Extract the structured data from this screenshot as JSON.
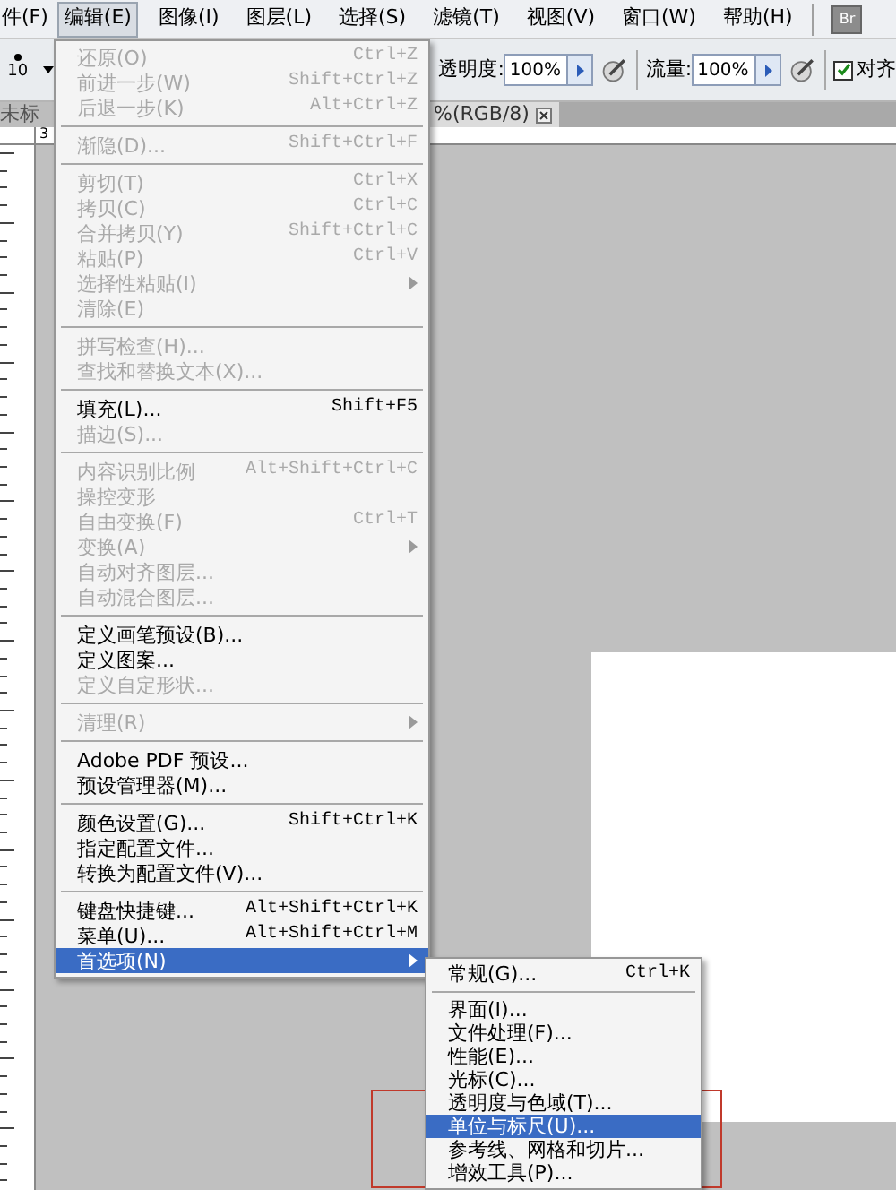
{
  "menubar": {
    "items": [
      {
        "label": "件(F)",
        "selected": false
      },
      {
        "label": "编辑(E)",
        "selected": true
      },
      {
        "label": "图像(I)",
        "selected": false
      },
      {
        "label": "图层(L)",
        "selected": false
      },
      {
        "label": "选择(S)",
        "selected": false
      },
      {
        "label": "滤镜(T)",
        "selected": false
      },
      {
        "label": "视图(V)",
        "selected": false
      },
      {
        "label": "窗口(W)",
        "selected": false
      },
      {
        "label": "帮助(H)",
        "selected": false
      }
    ],
    "bridge_button": "Br"
  },
  "options_bar": {
    "brush_size": "10",
    "opacity_label": "透明度:",
    "opacity_value": "100%",
    "flow_label": "流量:",
    "flow_value": "100%",
    "align": {
      "label": "对齐",
      "checked": true
    }
  },
  "document_tabs": [
    {
      "label": "未标",
      "selected": false
    },
    {
      "label": "%(RGB/8)",
      "selected": true
    }
  ],
  "ruler": {
    "label": "3"
  },
  "edit_menu": {
    "items": [
      {
        "kind": "item",
        "label": "还原(O)",
        "shortcut": "Ctrl+Z",
        "disabled": true
      },
      {
        "kind": "item",
        "label": "前进一步(W)",
        "shortcut": "Shift+Ctrl+Z",
        "disabled": true
      },
      {
        "kind": "item",
        "label": "后退一步(K)",
        "shortcut": "Alt+Ctrl+Z",
        "disabled": true
      },
      {
        "kind": "separator"
      },
      {
        "kind": "item",
        "label": "渐隐(D)...",
        "shortcut": "Shift+Ctrl+F",
        "disabled": true
      },
      {
        "kind": "separator"
      },
      {
        "kind": "item",
        "label": "剪切(T)",
        "shortcut": "Ctrl+X",
        "disabled": true
      },
      {
        "kind": "item",
        "label": "拷贝(C)",
        "shortcut": "Ctrl+C",
        "disabled": true
      },
      {
        "kind": "item",
        "label": "合并拷贝(Y)",
        "shortcut": "Shift+Ctrl+C",
        "disabled": true
      },
      {
        "kind": "item",
        "label": "粘贴(P)",
        "shortcut": "Ctrl+V",
        "disabled": true
      },
      {
        "kind": "item",
        "label": "选择性粘贴(I)",
        "submenu": true,
        "disabled": true
      },
      {
        "kind": "item",
        "label": "清除(E)",
        "disabled": true
      },
      {
        "kind": "separator"
      },
      {
        "kind": "item",
        "label": "拼写检查(H)...",
        "disabled": true
      },
      {
        "kind": "item",
        "label": "查找和替换文本(X)...",
        "disabled": true
      },
      {
        "kind": "separator"
      },
      {
        "kind": "item",
        "label": "填充(L)...",
        "shortcut": "Shift+F5",
        "disabled": false
      },
      {
        "kind": "item",
        "label": "描边(S)...",
        "disabled": true
      },
      {
        "kind": "separator"
      },
      {
        "kind": "item",
        "label": "内容识别比例",
        "shortcut": "Alt+Shift+Ctrl+C",
        "disabled": true
      },
      {
        "kind": "item",
        "label": "操控变形",
        "disabled": true
      },
      {
        "kind": "item",
        "label": "自由变换(F)",
        "shortcut": "Ctrl+T",
        "disabled": true
      },
      {
        "kind": "item",
        "label": "变换(A)",
        "submenu": true,
        "disabled": true
      },
      {
        "kind": "item",
        "label": "自动对齐图层...",
        "disabled": true
      },
      {
        "kind": "item",
        "label": "自动混合图层...",
        "disabled": true
      },
      {
        "kind": "separator"
      },
      {
        "kind": "item",
        "label": "定义画笔预设(B)...",
        "disabled": false
      },
      {
        "kind": "item",
        "label": "定义图案...",
        "disabled": false
      },
      {
        "kind": "item",
        "label": "定义自定形状...",
        "disabled": true
      },
      {
        "kind": "separator"
      },
      {
        "kind": "item",
        "label": "清理(R)",
        "submenu": true,
        "disabled": true
      },
      {
        "kind": "separator"
      },
      {
        "kind": "item",
        "label": "Adobe PDF 预设...",
        "disabled": false
      },
      {
        "kind": "item",
        "label": "预设管理器(M)...",
        "disabled": false
      },
      {
        "kind": "separator"
      },
      {
        "kind": "item",
        "label": "颜色设置(G)...",
        "shortcut": "Shift+Ctrl+K",
        "disabled": false
      },
      {
        "kind": "item",
        "label": "指定配置文件...",
        "disabled": false
      },
      {
        "kind": "item",
        "label": "转换为配置文件(V)...",
        "disabled": false
      },
      {
        "kind": "separator"
      },
      {
        "kind": "item",
        "label": "键盘快捷键...",
        "shortcut": "Alt+Shift+Ctrl+K",
        "disabled": false
      },
      {
        "kind": "item",
        "label": "菜单(U)...",
        "shortcut": "Alt+Shift+Ctrl+M",
        "disabled": false
      },
      {
        "kind": "item",
        "label": "首选项(N)",
        "submenu": true,
        "disabled": false,
        "selected": true
      }
    ]
  },
  "preferences_submenu": {
    "items": [
      {
        "kind": "item",
        "label": "常规(G)...",
        "shortcut": "Ctrl+K",
        "selected": false
      },
      {
        "kind": "separator"
      },
      {
        "kind": "item",
        "label": "界面(I)...",
        "selected": false
      },
      {
        "kind": "item",
        "label": "文件处理(F)...",
        "selected": false
      },
      {
        "kind": "item",
        "label": "性能(E)...",
        "selected": false
      },
      {
        "kind": "item",
        "label": "光标(C)...",
        "selected": false
      },
      {
        "kind": "item",
        "label": "透明度与色域(T)...",
        "selected": false
      },
      {
        "kind": "item",
        "label": "单位与标尺(U)...",
        "selected": true
      },
      {
        "kind": "item",
        "label": "参考线、网格和切片...",
        "selected": false
      },
      {
        "kind": "item",
        "label": "增效工具(P)...",
        "selected": false
      }
    ]
  }
}
